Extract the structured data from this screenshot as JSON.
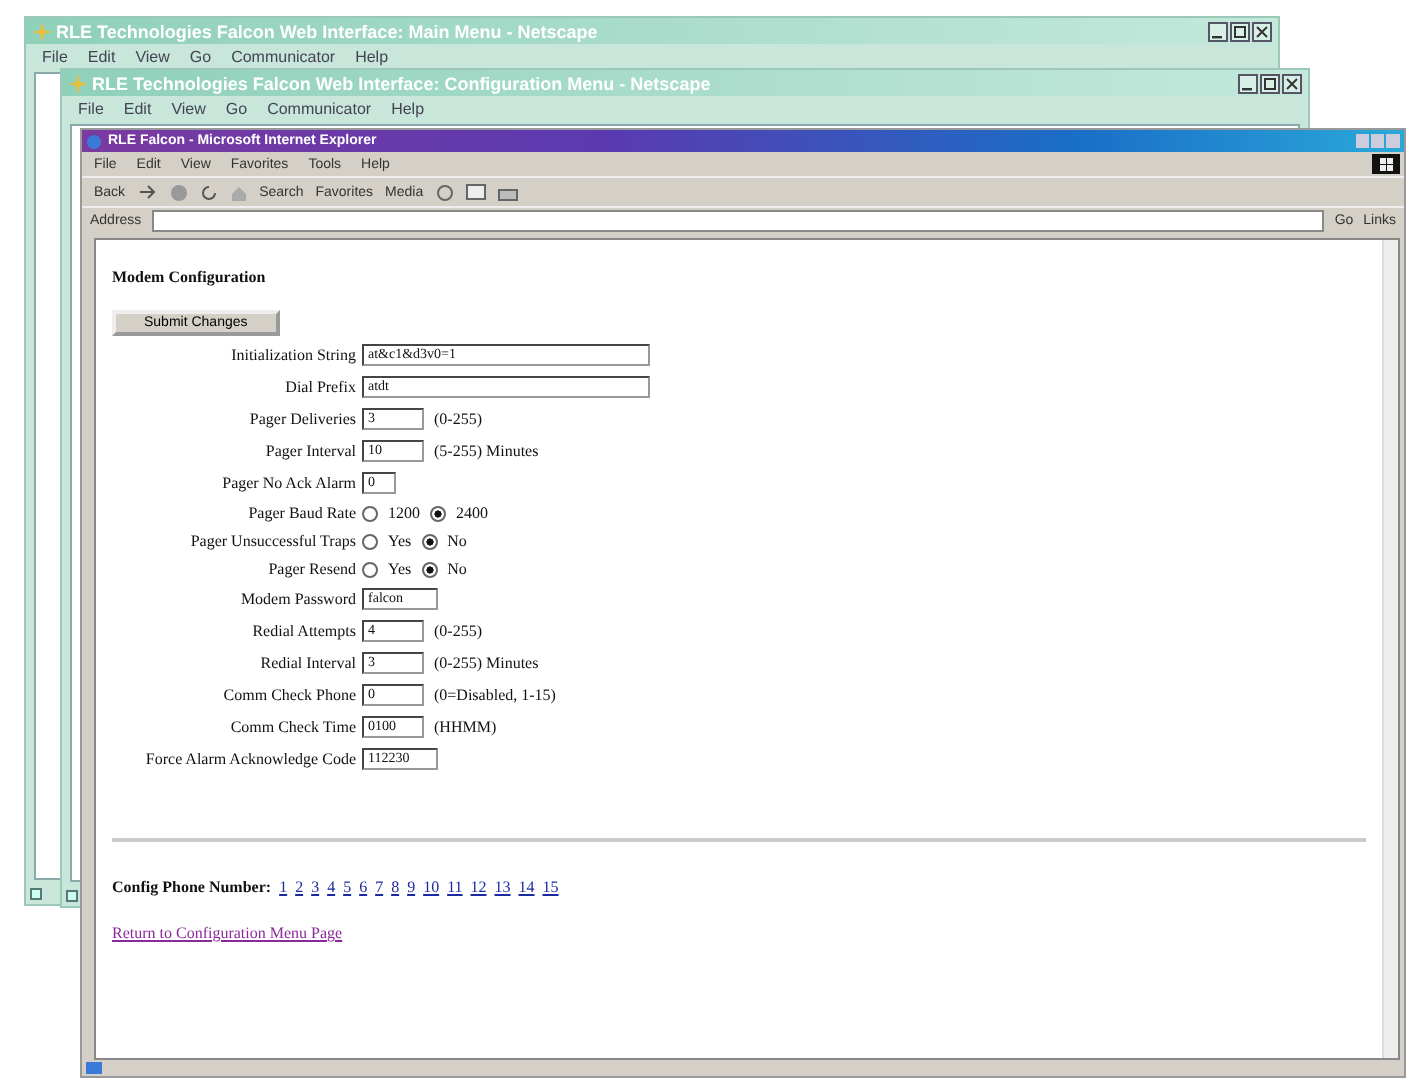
{
  "windows": [
    {
      "title": "RLE Technologies Falcon Web Interface: Main Menu - Netscape",
      "menu": [
        "File",
        "Edit",
        "View",
        "Go",
        "Communicator",
        "Help"
      ]
    },
    {
      "title": "RLE Technologies Falcon Web Interface: Configuration Menu - Netscape",
      "menu": [
        "File",
        "Edit",
        "View",
        "Go",
        "Communicator",
        "Help"
      ]
    }
  ],
  "browser": {
    "title": "RLE Falcon - Microsoft Internet Explorer",
    "menu": [
      "File",
      "Edit",
      "View",
      "Favorites",
      "Tools",
      "Help"
    ],
    "toolbar": [
      "Back",
      "Search",
      "Favorites",
      "Media"
    ],
    "address_label": "Address",
    "go": "Go",
    "links": "Links"
  },
  "page": {
    "heading": "Modem Configuration",
    "submit": "Submit Changes",
    "fields": [
      {
        "kind": "text",
        "label": "Initialization String",
        "value": "at&c1&d3v0=1"
      },
      {
        "kind": "text",
        "label": "Dial Prefix",
        "value": "atdt"
      },
      {
        "kind": "text",
        "label": "Pager Deliveries",
        "value": "3",
        "note": "(0-255)"
      },
      {
        "kind": "text",
        "label": "Pager Interval",
        "value": "10",
        "note": "(5-255) Minutes"
      },
      {
        "kind": "text",
        "label": "Pager No Ack Alarm",
        "value": "0"
      },
      {
        "kind": "radio",
        "label": "Pager Baud Rate",
        "options": [
          {
            "label": "1200",
            "selected": false
          },
          {
            "label": "2400",
            "selected": true
          }
        ]
      },
      {
        "kind": "radio",
        "label": "Pager Unsuccessful Traps",
        "options": [
          {
            "label": "Yes",
            "selected": false
          },
          {
            "label": "No",
            "selected": true
          }
        ]
      },
      {
        "kind": "radio",
        "label": "Pager Resend",
        "options": [
          {
            "label": "Yes",
            "selected": false
          },
          {
            "label": "No",
            "selected": true
          }
        ]
      },
      {
        "kind": "text",
        "label": "Modem Password",
        "value": "falcon"
      },
      {
        "kind": "text",
        "label": "Redial Attempts",
        "value": "4",
        "note": "(0-255)"
      },
      {
        "kind": "text",
        "label": "Redial Interval",
        "value": "3",
        "note": "(0-255) Minutes"
      },
      {
        "kind": "text",
        "label": "Comm Check Phone",
        "value": "0",
        "note": "(0=Disabled, 1-15)"
      },
      {
        "kind": "text",
        "label": "Comm Check Time",
        "value": "0100",
        "note": "(HHMM)"
      },
      {
        "kind": "text",
        "label": "Force Alarm Acknowledge Code",
        "value": "112230"
      }
    ],
    "phone_label": "Config Phone Number:",
    "phone_links": [
      "1",
      "2",
      "3",
      "4",
      "5",
      "6",
      "7",
      "8",
      "9",
      "10",
      "11",
      "12",
      "13",
      "14",
      "15"
    ],
    "return_link": "Return to Configuration Menu Page"
  }
}
